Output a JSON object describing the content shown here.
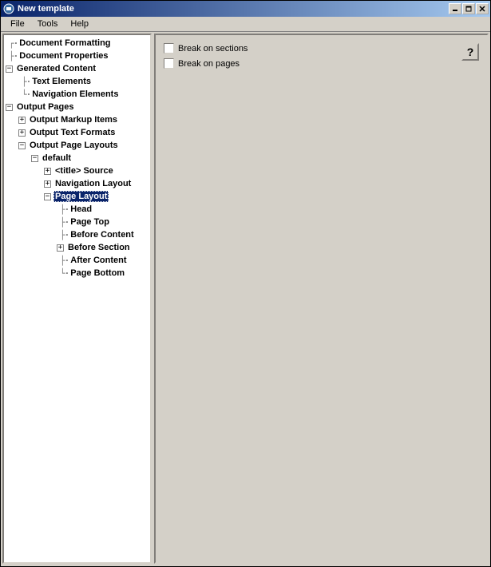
{
  "window": {
    "title": "New template"
  },
  "menubar": {
    "file": "File",
    "tools": "Tools",
    "help": "Help"
  },
  "tree": {
    "doc_formatting": "Document Formatting",
    "doc_properties": "Document Properties",
    "generated_content": "Generated Content",
    "text_elements": "Text Elements",
    "navigation_elements": "Navigation Elements",
    "output_pages": "Output Pages",
    "output_markup_items": "Output Markup Items",
    "output_text_formats": "Output Text Formats",
    "output_page_layouts": "Output Page Layouts",
    "default": "default",
    "title_source": "<title> Source",
    "navigation_layout": "Navigation Layout",
    "page_layout": "Page Layout",
    "head": "Head",
    "page_top": "Page Top",
    "before_content": "Before Content",
    "before_section": "Before Section",
    "after_content": "After Content",
    "page_bottom": "Page Bottom"
  },
  "right": {
    "break_sections": "Break on sections",
    "break_pages": "Break on pages",
    "help": "?"
  },
  "glyph": {
    "plus": "+",
    "minus": "−"
  }
}
